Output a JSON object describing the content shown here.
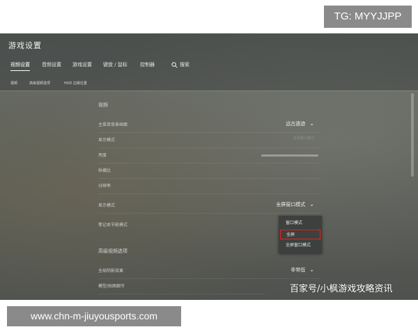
{
  "overlay_top": "TG: MYYJJPP",
  "overlay_bottom": "www.chn-m-jiuyousports.com",
  "watermark": "百家号/小枫游戏攻略资讯",
  "app": {
    "title": "游戏设置"
  },
  "tabs": [
    {
      "label": "视频设置",
      "active": true
    },
    {
      "label": "音频设置",
      "active": false
    },
    {
      "label": "游戏设置",
      "active": false
    },
    {
      "label": "键盘 / 鼠标",
      "active": false
    },
    {
      "label": "控制器",
      "active": false
    }
  ],
  "search_label": "搜索",
  "subtabs": [
    "视频",
    "高级视频选项",
    "HUD 边缘位置"
  ],
  "sections": {
    "video": "视频",
    "advanced": "高级视频选项"
  },
  "rows": [
    {
      "label": "主菜单背景画面",
      "value": "远古遗迹",
      "dropdown": true
    },
    {
      "label": "显示模式",
      "value": "全屏窗口模式",
      "dim": true
    },
    {
      "label": "亮度",
      "value": "",
      "slider": true
    },
    {
      "label": "纵横比",
      "value": ""
    },
    {
      "label": "分辨率",
      "value": ""
    },
    {
      "label": "显示模式",
      "value": "全屏窗口模式",
      "dropdown": true
    },
    {
      "label": "笔记本节能模式",
      "value": ""
    }
  ],
  "advanced_rows": [
    {
      "label": "全局阴影效果",
      "value": "非常低",
      "dropdown": true
    },
    {
      "label": "模型/贴图细节",
      "value": ""
    }
  ],
  "display_mode_menu": {
    "options": [
      "窗口模式",
      "全屏",
      "全屏窗口模式"
    ],
    "highlighted": "全屏"
  },
  "colors": {
    "highlight_border": "#e0241b"
  }
}
